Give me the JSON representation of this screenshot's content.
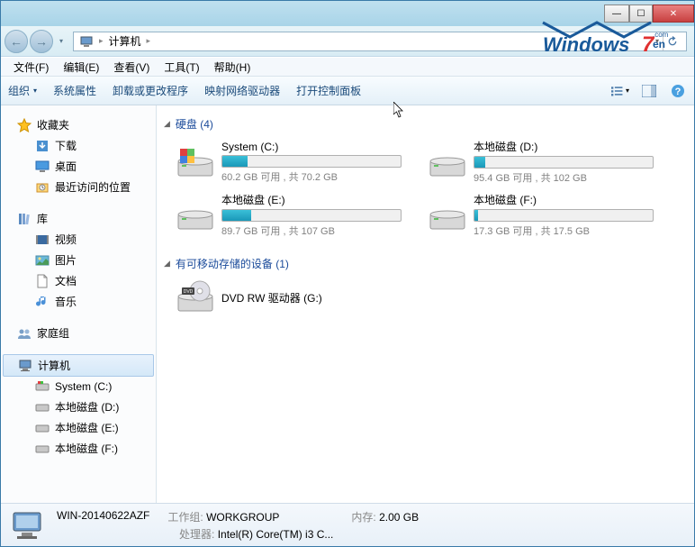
{
  "titlebar": {
    "min": "—",
    "max": "☐",
    "close": "✕"
  },
  "nav": {
    "back": "←",
    "forward": "→",
    "computer_icon_label": "计算机",
    "path": "计算机",
    "sep": "▸",
    "dropdown": "▾",
    "refresh": "↻"
  },
  "menu": {
    "file": "文件(F)",
    "edit": "编辑(E)",
    "view": "查看(V)",
    "tools": "工具(T)",
    "help": "帮助(H)"
  },
  "toolbar": {
    "organize": "组织",
    "sys_props": "系统属性",
    "uninstall": "卸载或更改程序",
    "map_drive": "映射网络驱动器",
    "control_panel": "打开控制面板",
    "view_dropdown": "▾",
    "help": "?"
  },
  "sidebar": {
    "favorites": {
      "label": "收藏夹",
      "items": [
        {
          "label": "下载"
        },
        {
          "label": "桌面"
        },
        {
          "label": "最近访问的位置"
        }
      ]
    },
    "libraries": {
      "label": "库",
      "items": [
        {
          "label": "视频"
        },
        {
          "label": "图片"
        },
        {
          "label": "文档"
        },
        {
          "label": "音乐"
        }
      ]
    },
    "homegroup": {
      "label": "家庭组"
    },
    "computer": {
      "label": "计算机",
      "items": [
        {
          "label": "System (C:)"
        },
        {
          "label": "本地磁盘 (D:)"
        },
        {
          "label": "本地磁盘 (E:)"
        },
        {
          "label": "本地磁盘 (F:)"
        }
      ]
    }
  },
  "main": {
    "hdd_section": "硬盘 (4)",
    "removable_section": "有可移动存储的设备 (1)",
    "drives": [
      {
        "name": "System (C:)",
        "free": "60.2 GB 可用 , 共 70.2 GB",
        "fill": 14
      },
      {
        "name": "本地磁盘 (D:)",
        "free": "95.4 GB 可用 , 共 102 GB",
        "fill": 6
      },
      {
        "name": "本地磁盘 (E:)",
        "free": "89.7 GB 可用 , 共 107 GB",
        "fill": 16
      },
      {
        "name": "本地磁盘 (F:)",
        "free": "17.3 GB 可用 , 共 17.5 GB",
        "fill": 2
      }
    ],
    "removable": [
      {
        "name": "DVD RW 驱动器 (G:)"
      }
    ]
  },
  "status": {
    "name": "WIN-20140622AZF",
    "workgroup_label": "工作组:",
    "workgroup": "WORKGROUP",
    "memory_label": "内存:",
    "memory": "2.00 GB",
    "cpu_label": "处理器:",
    "cpu": "Intel(R) Core(TM) i3 C..."
  },
  "watermark": {
    "text": "Windows7en",
    "suffix": ".com"
  }
}
